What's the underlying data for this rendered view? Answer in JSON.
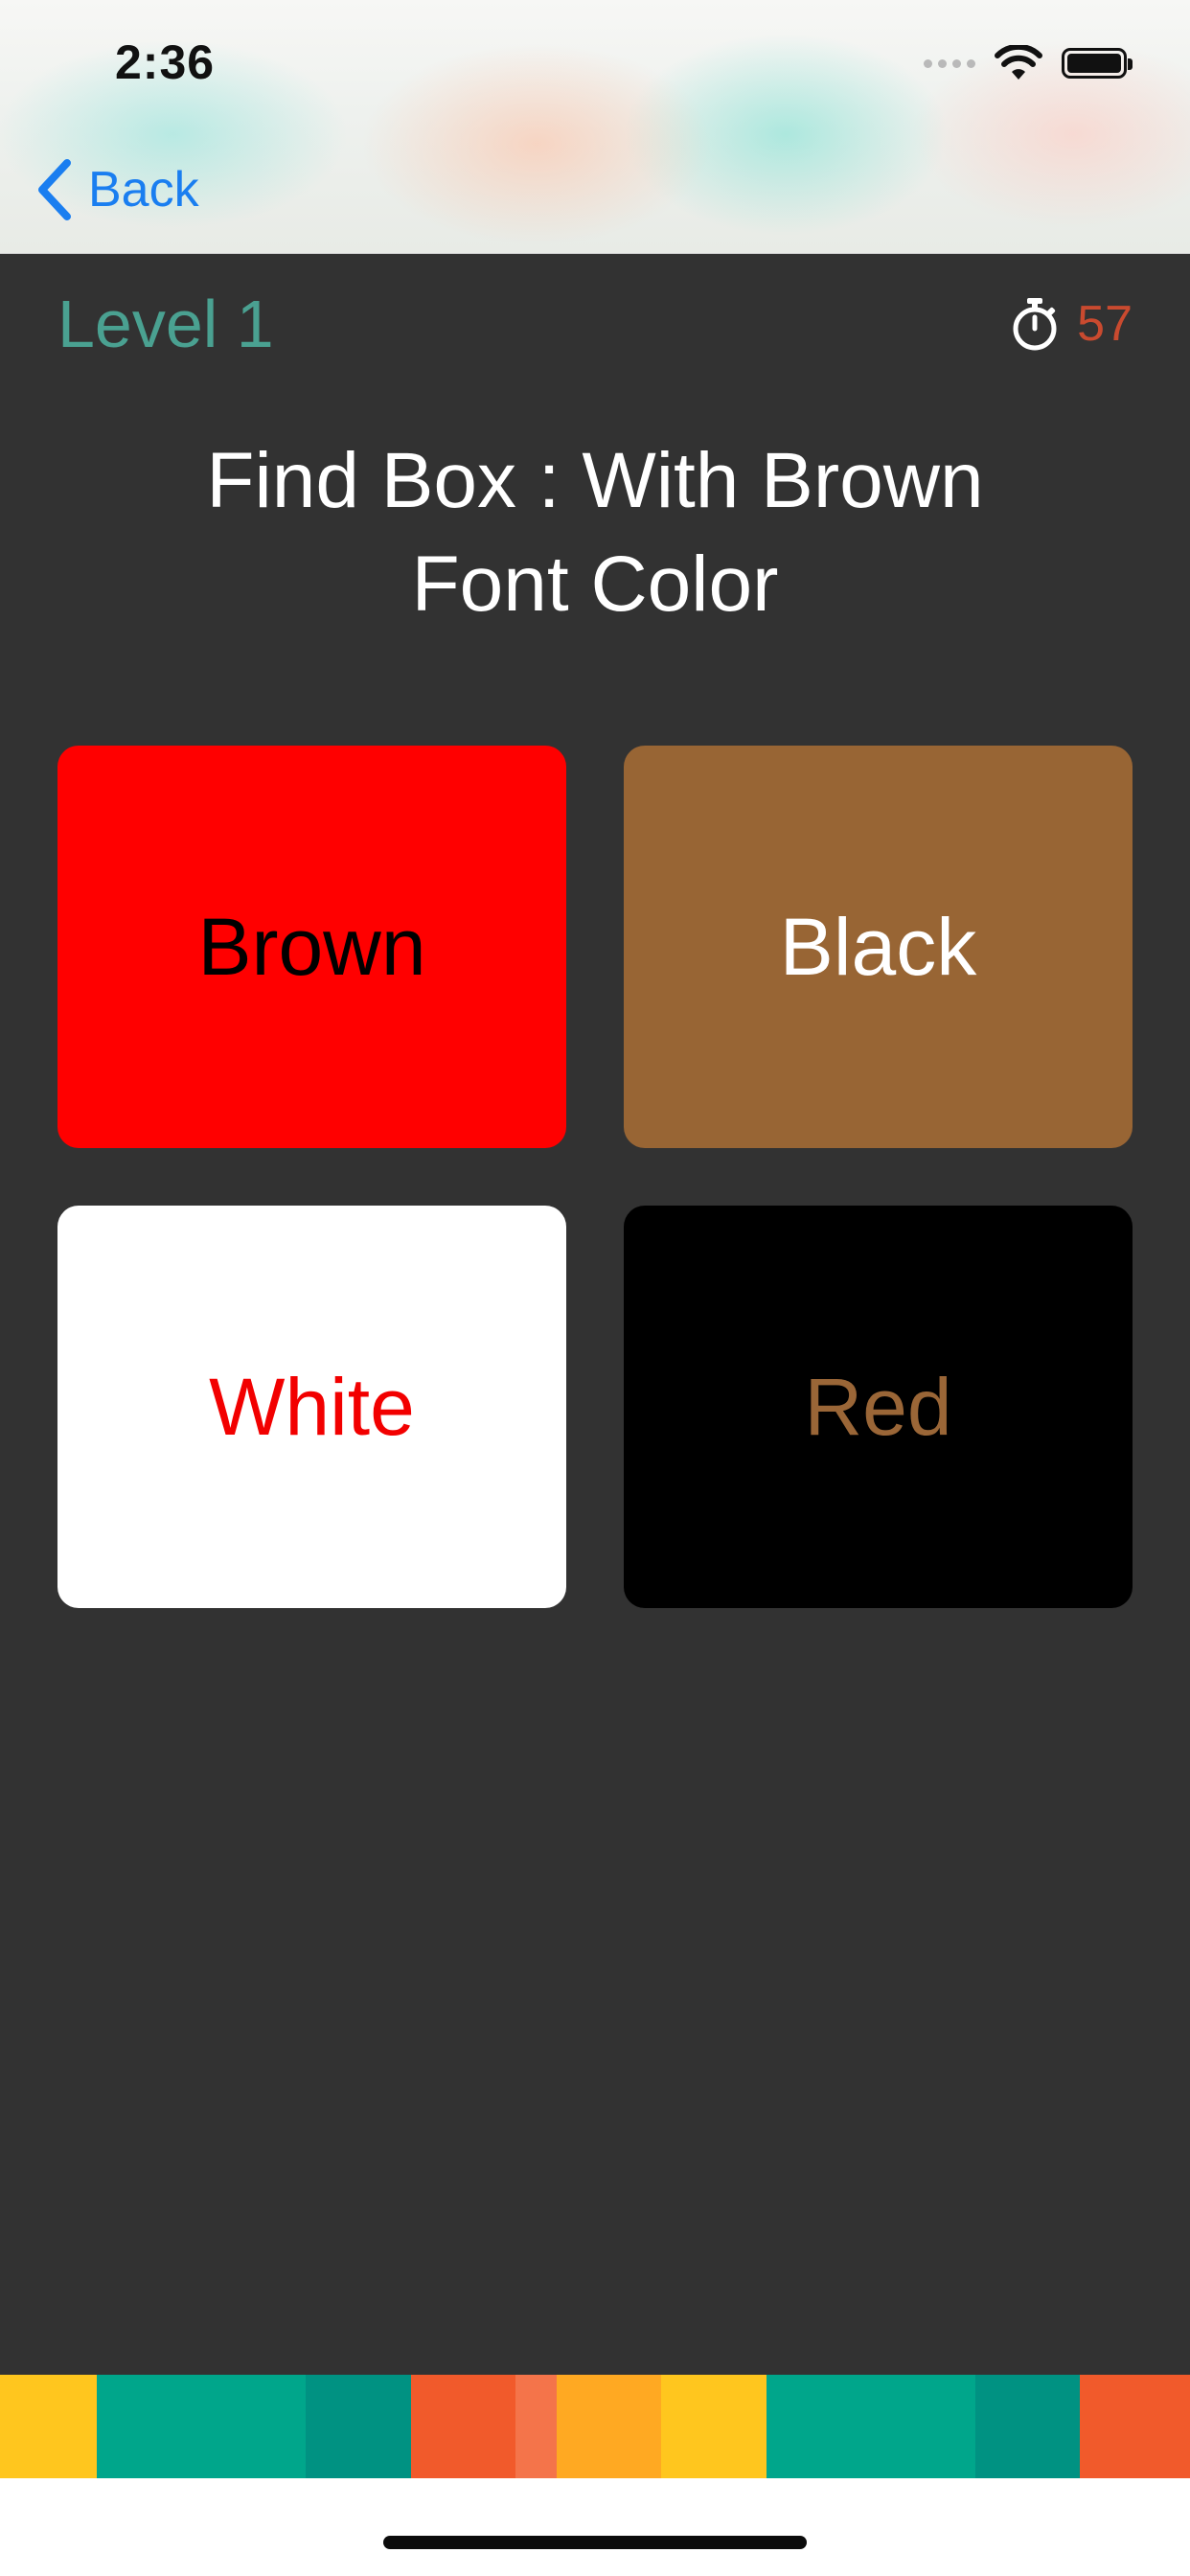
{
  "status_bar": {
    "time": "2:36"
  },
  "nav": {
    "back_label": "Back"
  },
  "game": {
    "level_label": "Level 1",
    "timer_value": "57",
    "prompt_line1": "Find Box : With Brown",
    "prompt_line2": "Font Color"
  },
  "boxes": [
    {
      "label": "Brown",
      "background": "#ff0000",
      "text_color": "#000000"
    },
    {
      "label": "Black",
      "background": "#986534",
      "text_color": "#ffffff"
    },
    {
      "label": "White",
      "background": "#ffffff",
      "text_color": "#f20000"
    },
    {
      "label": "Red",
      "background": "#000000",
      "text_color": "#9a6637"
    }
  ],
  "colors": {
    "background": "#323232",
    "level": "#4aa191",
    "timer": "#c94a2f",
    "link": "#1a7ef0"
  },
  "color_strip": [
    "#ffc61e",
    "#00a68b",
    "#00a68b",
    "#009282",
    "#f15a2b",
    "#f4744a",
    "#ffa922",
    "#ffc61e",
    "#00a68b",
    "#00a68b",
    "#009282",
    "#f15a2b"
  ]
}
